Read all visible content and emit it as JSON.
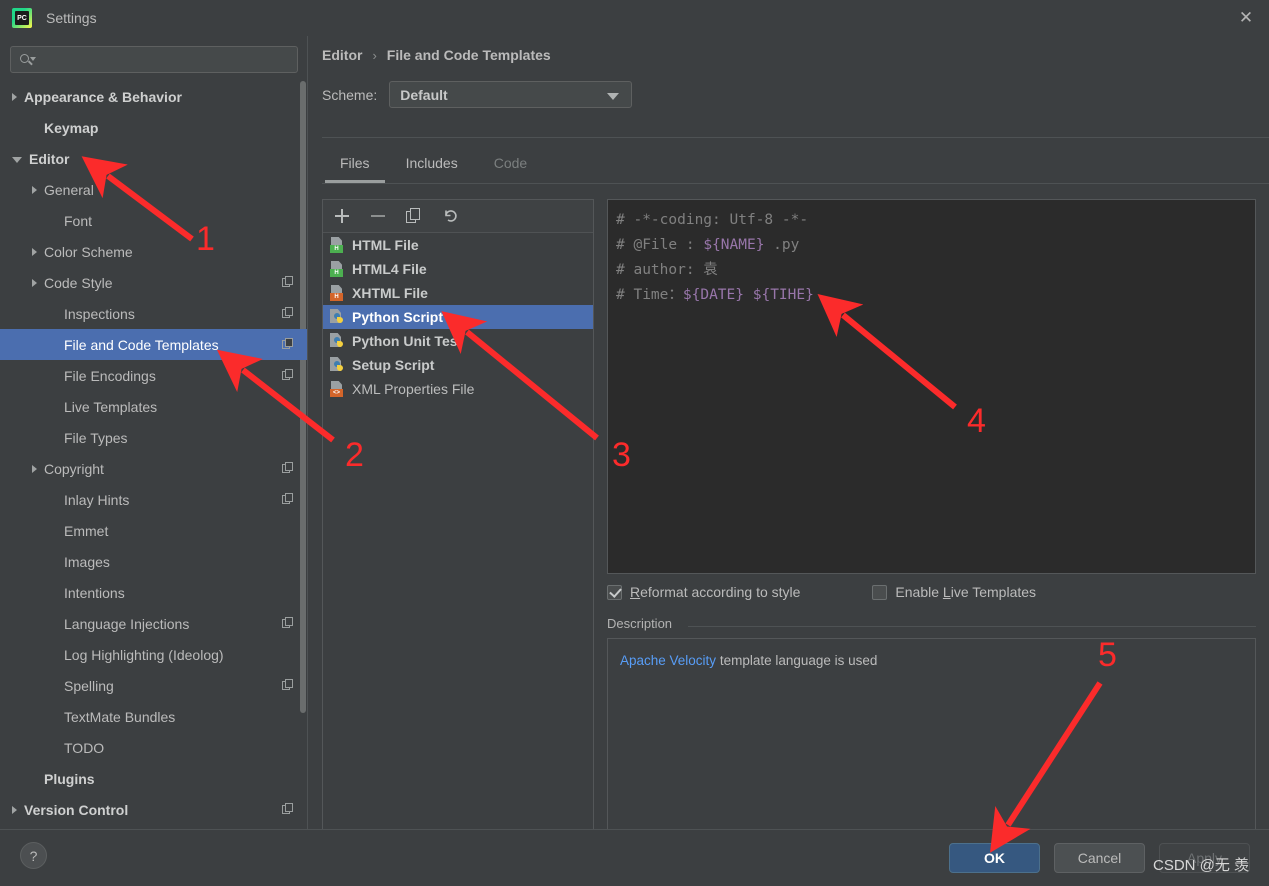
{
  "window": {
    "title": "Settings",
    "logo_text": "PC",
    "close_icon": "close-icon"
  },
  "sidebar": {
    "search": {
      "value": "",
      "placeholder": ""
    },
    "items": [
      {
        "label": "Appearance & Behavior",
        "arrow": "right",
        "indent": 0,
        "bold": true,
        "copy": false,
        "selected": false
      },
      {
        "label": "Keymap",
        "arrow": "none",
        "indent": 1,
        "bold": true,
        "copy": false,
        "selected": false
      },
      {
        "label": "Editor",
        "arrow": "down",
        "indent": 0,
        "bold": true,
        "copy": false,
        "selected": false
      },
      {
        "label": "General",
        "arrow": "right",
        "indent": 1,
        "bold": false,
        "copy": false,
        "selected": false
      },
      {
        "label": "Font",
        "arrow": "none",
        "indent": 2,
        "bold": false,
        "copy": false,
        "selected": false
      },
      {
        "label": "Color Scheme",
        "arrow": "right",
        "indent": 1,
        "bold": false,
        "copy": false,
        "selected": false
      },
      {
        "label": "Code Style",
        "arrow": "right",
        "indent": 1,
        "bold": false,
        "copy": true,
        "selected": false
      },
      {
        "label": "Inspections",
        "arrow": "none",
        "indent": 2,
        "bold": false,
        "copy": true,
        "selected": false
      },
      {
        "label": "File and Code Templates",
        "arrow": "none",
        "indent": 2,
        "bold": false,
        "copy": true,
        "selected": true
      },
      {
        "label": "File Encodings",
        "arrow": "none",
        "indent": 2,
        "bold": false,
        "copy": true,
        "selected": false
      },
      {
        "label": "Live Templates",
        "arrow": "none",
        "indent": 2,
        "bold": false,
        "copy": false,
        "selected": false
      },
      {
        "label": "File Types",
        "arrow": "none",
        "indent": 2,
        "bold": false,
        "copy": false,
        "selected": false
      },
      {
        "label": "Copyright",
        "arrow": "right",
        "indent": 1,
        "bold": false,
        "copy": true,
        "selected": false
      },
      {
        "label": "Inlay Hints",
        "arrow": "none",
        "indent": 2,
        "bold": false,
        "copy": true,
        "selected": false
      },
      {
        "label": "Emmet",
        "arrow": "none",
        "indent": 2,
        "bold": false,
        "copy": false,
        "selected": false
      },
      {
        "label": "Images",
        "arrow": "none",
        "indent": 2,
        "bold": false,
        "copy": false,
        "selected": false
      },
      {
        "label": "Intentions",
        "arrow": "none",
        "indent": 2,
        "bold": false,
        "copy": false,
        "selected": false
      },
      {
        "label": "Language Injections",
        "arrow": "none",
        "indent": 2,
        "bold": false,
        "copy": true,
        "selected": false
      },
      {
        "label": "Log Highlighting (Ideolog)",
        "arrow": "none",
        "indent": 2,
        "bold": false,
        "copy": false,
        "selected": false
      },
      {
        "label": "Spelling",
        "arrow": "none",
        "indent": 2,
        "bold": false,
        "copy": true,
        "selected": false
      },
      {
        "label": "TextMate Bundles",
        "arrow": "none",
        "indent": 2,
        "bold": false,
        "copy": false,
        "selected": false
      },
      {
        "label": "TODO",
        "arrow": "none",
        "indent": 2,
        "bold": false,
        "copy": false,
        "selected": false
      },
      {
        "label": "Plugins",
        "arrow": "none",
        "indent": 1,
        "bold": true,
        "copy": false,
        "selected": false
      },
      {
        "label": "Version Control",
        "arrow": "right",
        "indent": 0,
        "bold": true,
        "copy": true,
        "selected": false
      }
    ]
  },
  "main": {
    "breadcrumb": {
      "parent": "Editor",
      "separator": "›",
      "current": "File and Code Templates"
    },
    "scheme": {
      "label": "Scheme:",
      "value": "Default"
    },
    "tabs": [
      {
        "label": "Files",
        "active": true,
        "dim": false
      },
      {
        "label": "Includes",
        "active": false,
        "dim": false
      },
      {
        "label": "Code",
        "active": false,
        "dim": true
      }
    ],
    "list_toolbar": [
      {
        "icon": "plus-icon",
        "name": "add-template-button"
      },
      {
        "icon": "minus-icon",
        "name": "remove-template-button"
      },
      {
        "icon": "copy-icon",
        "name": "copy-template-button"
      },
      {
        "icon": "undo-icon",
        "name": "reset-template-button"
      }
    ],
    "templates": [
      {
        "label": "HTML File",
        "icon": "html-file-icon",
        "badge": "H",
        "badge_color": "green",
        "selected": false,
        "bold": true
      },
      {
        "label": "HTML4 File",
        "icon": "html-file-icon",
        "badge": "H",
        "badge_color": "green",
        "selected": false,
        "bold": true
      },
      {
        "label": "XHTML File",
        "icon": "xhtml-file-icon",
        "badge": "H",
        "badge_color": "orange",
        "selected": false,
        "bold": true
      },
      {
        "label": "Python Script",
        "icon": "python-file-icon",
        "badge": "",
        "badge_color": "",
        "selected": true,
        "bold": true
      },
      {
        "label": "Python Unit Test",
        "icon": "python-file-icon",
        "badge": "",
        "badge_color": "",
        "selected": false,
        "bold": true
      },
      {
        "label": "Setup Script",
        "icon": "python-file-icon",
        "badge": "",
        "badge_color": "",
        "selected": false,
        "bold": true
      },
      {
        "label": "XML Properties File",
        "icon": "xml-file-icon",
        "badge": "<>",
        "badge_color": "orange",
        "selected": false,
        "bold": false
      }
    ],
    "editor_lines": [
      [
        {
          "t": "# -*-coding: Utf-8 -*-",
          "k": "txt"
        }
      ],
      [
        {
          "t": "# @File : ",
          "k": "txt"
        },
        {
          "t": "${NAME}",
          "k": "var"
        },
        {
          "t": " .py",
          "k": "txt"
        }
      ],
      [
        {
          "t": "# author: 袁",
          "k": "txt"
        }
      ],
      [
        {
          "t": "# Time：",
          "k": "txt"
        },
        {
          "t": "${DATE}",
          "k": "var"
        },
        {
          "t": " ",
          "k": "txt"
        },
        {
          "t": "${TIHE}",
          "k": "var"
        }
      ]
    ],
    "checkboxes": [
      {
        "label_pre": "",
        "mnemonic": "R",
        "label_post": "eformat according to style",
        "checked": true
      },
      {
        "label_pre": "Enable ",
        "mnemonic": "L",
        "label_post": "ive Templates",
        "checked": false
      }
    ],
    "description": {
      "title": "Description",
      "link_text": "Apache Velocity",
      "rest_text": " template language is used"
    }
  },
  "footer": {
    "help_label": "?",
    "ok_label": "OK",
    "cancel_label": "Cancel",
    "apply_label": "Apply",
    "watermark": "CSDN @无 羡"
  },
  "annotations": {
    "numbers": [
      "1",
      "2",
      "3",
      "4",
      "5"
    ],
    "color": "#fb2b2b"
  }
}
